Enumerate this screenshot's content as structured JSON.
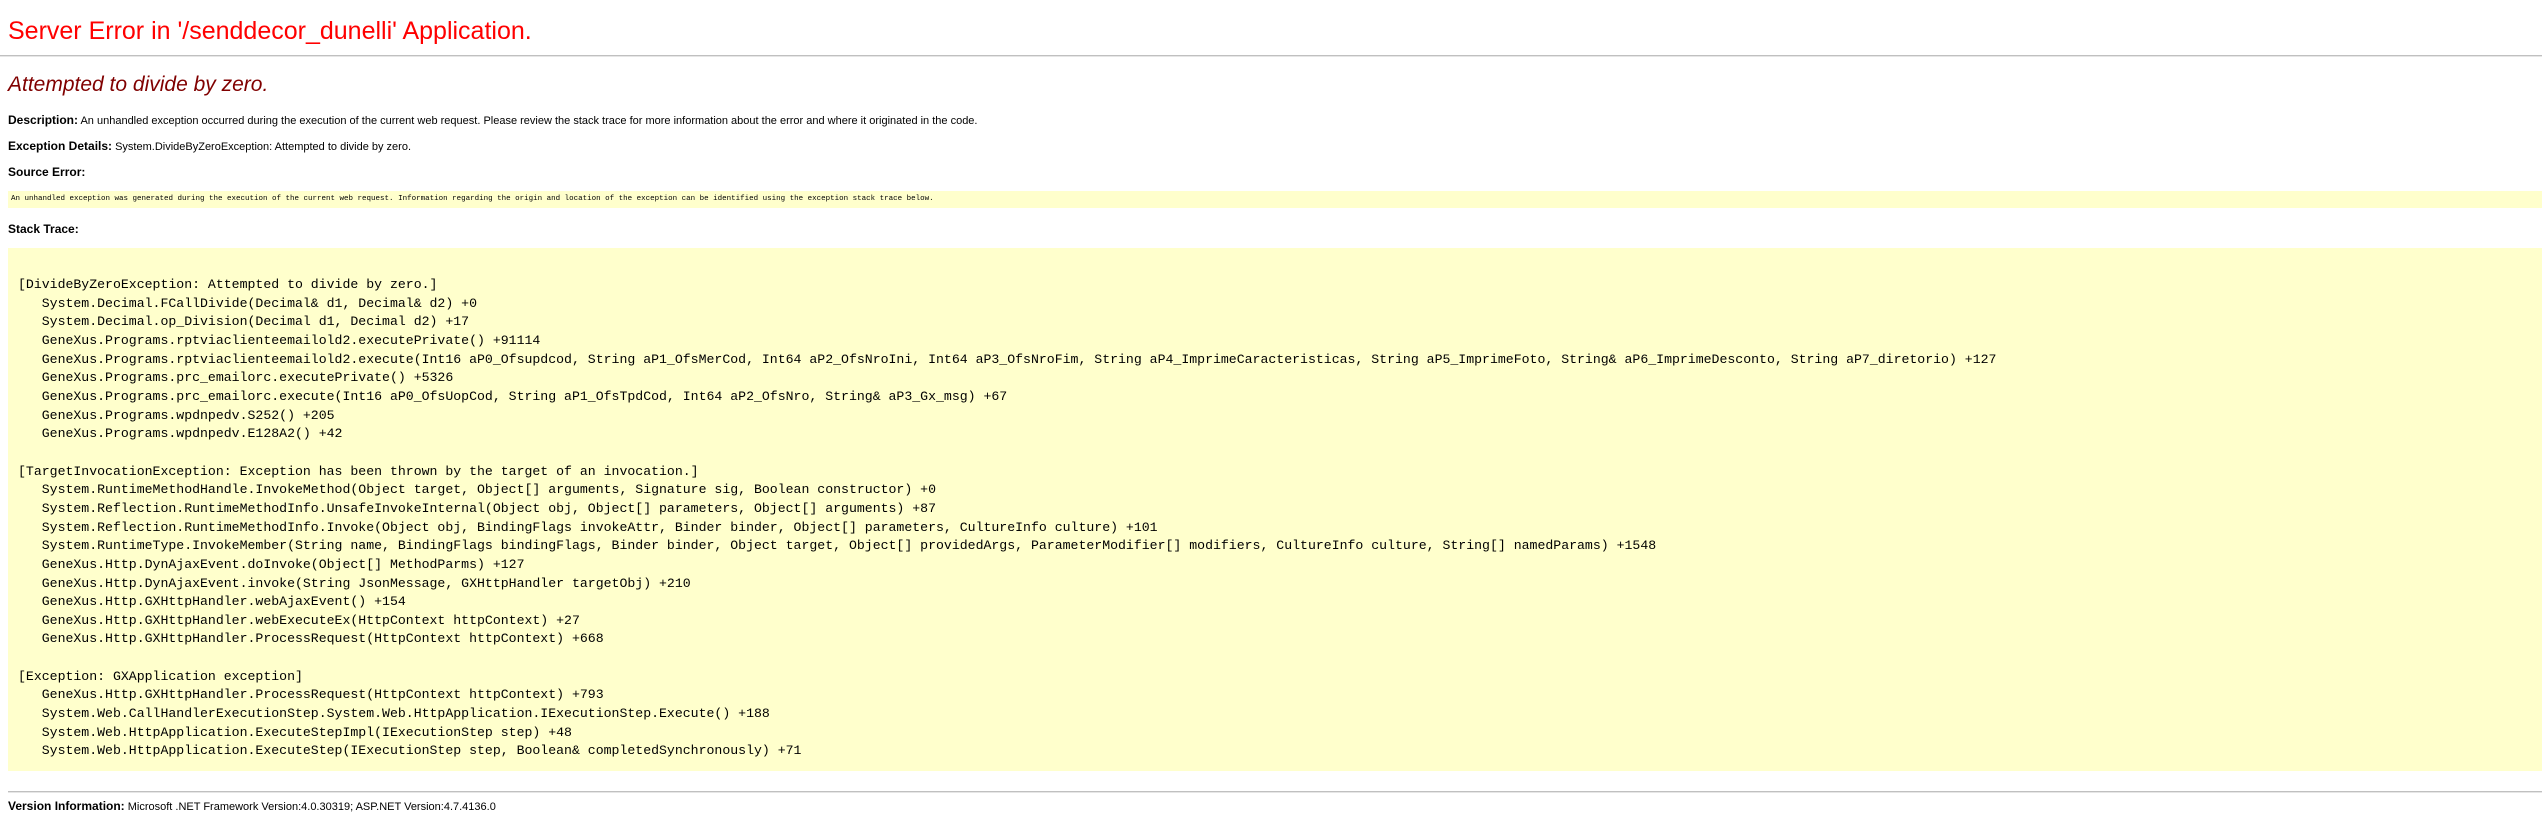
{
  "title": "Server Error in '/senddecor_dunelli' Application.",
  "subtitle": "Attempted to divide by zero.",
  "description": {
    "label": "Description:",
    "text": " An unhandled exception occurred during the execution of the current web request. Please review the stack trace for more information about the error and where it originated in the code."
  },
  "exception_details": {
    "label": "Exception Details:",
    "text": " System.DivideByZeroException: Attempted to divide by zero."
  },
  "source_error": {
    "label": "Source Error:",
    "text": "An unhandled exception was generated during the execution of the current web request. Information regarding the origin and location of the exception can be identified using the exception stack trace below."
  },
  "stack_trace": {
    "label": "Stack Trace:",
    "lines": [
      "[DivideByZeroException: Attempted to divide by zero.]",
      "   System.Decimal.FCallDivide(Decimal& d1, Decimal& d2) +0",
      "   System.Decimal.op_Division(Decimal d1, Decimal d2) +17",
      "   GeneXus.Programs.rptviaclienteemailold2.executePrivate() +91114",
      "   GeneXus.Programs.rptviaclienteemailold2.execute(Int16 aP0_Ofsupdcod, String aP1_OfsMerCod, Int64 aP2_OfsNroIni, Int64 aP3_OfsNroFim, String aP4_ImprimeCaracteristicas, String aP5_ImprimeFoto, String& aP6_ImprimeDesconto, String aP7_diretorio) +127",
      "   GeneXus.Programs.prc_emailorc.executePrivate() +5326",
      "   GeneXus.Programs.prc_emailorc.execute(Int16 aP0_OfsUopCod, String aP1_OfsTpdCod, Int64 aP2_OfsNro, String& aP3_Gx_msg) +67",
      "   GeneXus.Programs.wpdnpedv.S252() +205",
      "   GeneXus.Programs.wpdnpedv.E128A2() +42",
      "",
      "[TargetInvocationException: Exception has been thrown by the target of an invocation.]",
      "   System.RuntimeMethodHandle.InvokeMethod(Object target, Object[] arguments, Signature sig, Boolean constructor) +0",
      "   System.Reflection.RuntimeMethodInfo.UnsafeInvokeInternal(Object obj, Object[] parameters, Object[] arguments) +87",
      "   System.Reflection.RuntimeMethodInfo.Invoke(Object obj, BindingFlags invokeAttr, Binder binder, Object[] parameters, CultureInfo culture) +101",
      "   System.RuntimeType.InvokeMember(String name, BindingFlags bindingFlags, Binder binder, Object target, Object[] providedArgs, ParameterModifier[] modifiers, CultureInfo culture, String[] namedParams) +1548",
      "   GeneXus.Http.DynAjaxEvent.doInvoke(Object[] MethodParms) +127",
      "   GeneXus.Http.DynAjaxEvent.invoke(String JsonMessage, GXHttpHandler targetObj) +210",
      "   GeneXus.Http.GXHttpHandler.webAjaxEvent() +154",
      "   GeneXus.Http.GXHttpHandler.webExecuteEx(HttpContext httpContext) +27",
      "   GeneXus.Http.GXHttpHandler.ProcessRequest(HttpContext httpContext) +668",
      "",
      "[Exception: GXApplication exception]",
      "   GeneXus.Http.GXHttpHandler.ProcessRequest(HttpContext httpContext) +793",
      "   System.Web.CallHandlerExecutionStep.System.Web.HttpApplication.IExecutionStep.Execute() +188",
      "   System.Web.HttpApplication.ExecuteStepImpl(IExecutionStep step) +48",
      "   System.Web.HttpApplication.ExecuteStep(IExecutionStep step, Boolean& completedSynchronously) +71"
    ]
  },
  "version_info": {
    "label": "Version Information:",
    "text": " Microsoft .NET Framework Version:4.0.30319; ASP.NET Version:4.7.4136.0"
  }
}
